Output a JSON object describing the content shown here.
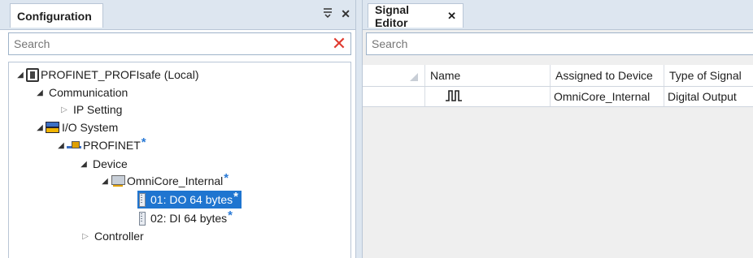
{
  "left_panel": {
    "tab_label": "Configuration",
    "pin_icon": "pin-icon",
    "close_glyph": "✕",
    "search_placeholder": "Search",
    "clear_glyph": "✕"
  },
  "tree": {
    "station": "PROFINET_PROFIsafe (Local)",
    "communication": "Communication",
    "ip_setting": "IP Setting",
    "io_system": "I/O System",
    "profinet": "PROFINET",
    "device": "Device",
    "omnicore": "OmniCore_Internal",
    "module1": "01: DO 64 bytes",
    "module2": "02: DI 64 bytes",
    "controller": "Controller",
    "modified_marker": "*"
  },
  "right_panel": {
    "tab_label": "Signal Editor",
    "close_glyph": "✕",
    "search_placeholder": "Search",
    "columns": [
      "Name",
      "Assigned to Device",
      "Type of Signal"
    ],
    "rows": [
      {
        "name_icon": "digital-signal-icon",
        "assigned_to_device": "OmniCore_Internal",
        "type_of_signal": "Digital Output"
      }
    ]
  },
  "colors": {
    "accent": "#1f75d0",
    "modified_star": "#2a7ad6",
    "clear_red": "#e03c31",
    "header_bg": "#dde6f0"
  }
}
